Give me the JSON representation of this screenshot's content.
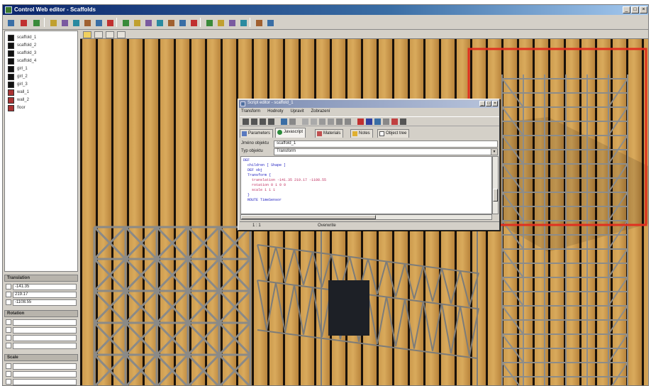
{
  "window": {
    "title": "Control Web editor - Scaffolds",
    "controls": [
      "_",
      "□",
      "×"
    ]
  },
  "toolbar": {
    "icons": [
      "new-icon",
      "open-icon",
      "save-icon",
      "cut-icon",
      "copy-icon",
      "paste-icon",
      "move-icon",
      "rotate-icon",
      "scale-icon",
      "select-icon",
      "link-icon",
      "unlink-icon",
      "grid-icon",
      "snap-icon",
      "align-icon",
      "distribute-icon",
      "zoom-icon",
      "view-icon",
      "camera-icon",
      "light-icon",
      "render-icon",
      "help-icon"
    ]
  },
  "sidebar": {
    "objects": [
      {
        "label": "scaffold_1",
        "kind": "black"
      },
      {
        "label": "scaffold_2",
        "kind": "black"
      },
      {
        "label": "scaffold_3",
        "kind": "black"
      },
      {
        "label": "scaffold_4",
        "kind": "black"
      },
      {
        "label": "girl_1",
        "kind": "black"
      },
      {
        "label": "girl_2",
        "kind": "black"
      },
      {
        "label": "girl_3",
        "kind": "black"
      },
      {
        "label": "wall_1",
        "kind": "red"
      },
      {
        "label": "wall_2",
        "kind": "red"
      },
      {
        "label": "floor",
        "kind": "red"
      }
    ],
    "translation": {
      "label": "Translation",
      "x": "-141.35",
      "y": "219.17",
      "z": "-1108.55"
    },
    "rotation": {
      "label": "Rotation",
      "x": "",
      "y": "",
      "z": "",
      "w": ""
    },
    "scale": {
      "label": "Scale",
      "x": "",
      "y": "",
      "z": ""
    }
  },
  "editor": {
    "title": "Script editor - scaffold_1",
    "menu": [
      "Transform",
      "Hodnoty",
      "Upravit",
      "Zobrazení"
    ],
    "tabs": [
      {
        "label": "Parameters",
        "active": false
      },
      {
        "label": "Javascript",
        "active": true
      },
      {
        "label": "Materials",
        "active": false
      },
      {
        "label": "Notes",
        "active": false
      },
      {
        "label": "Object tree",
        "active": false
      }
    ],
    "name_label": "Jméno objektu",
    "name_value": "scaffold_1",
    "type_label": "Typ objektu",
    "type_value": "Transform",
    "code": [
      "DEF",
      "  children [ Shape ]",
      "  DEF obj",
      "  Transform {",
      "    translation -141.35 219.17 -1108.55",
      "    rotation 0 1 0 0",
      "    scale 1 1 1",
      "  }",
      "  ROUTE TimeSensor"
    ],
    "status_pos": "1 : 1",
    "status_mode": "Overwrite"
  }
}
